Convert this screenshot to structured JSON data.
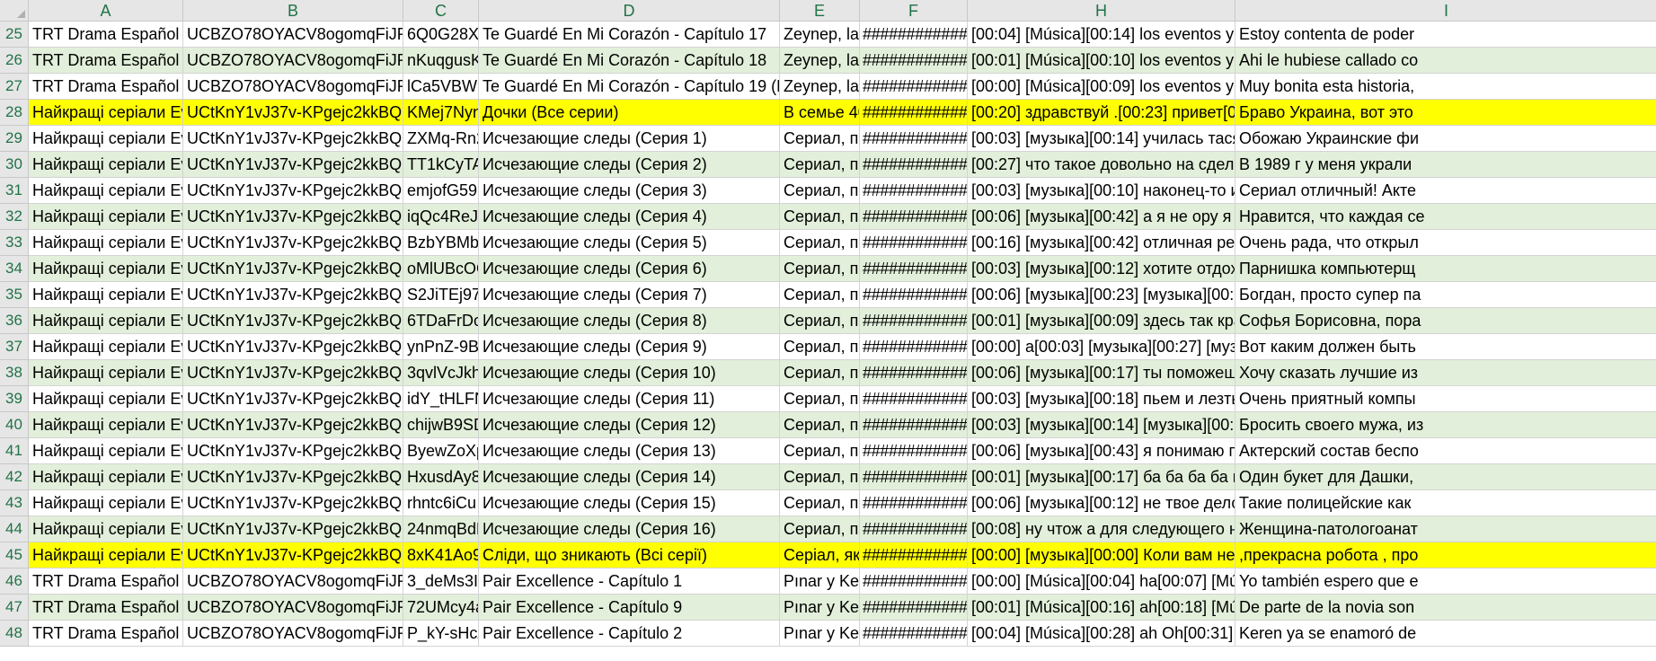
{
  "columns": [
    "A",
    "B",
    "C",
    "D",
    "E",
    "F",
    "H",
    "I"
  ],
  "rows": [
    {
      "num": "25",
      "band": "white",
      "cells": [
        "TRT Drama Español",
        "UCBZO78OYACV8ogomqFiJR4Q",
        "6Q0G28XU",
        "Te Guardé En Mi Corazón - Capítulo 17",
        "Zeynep, la g",
        "############",
        "[00:04] [Música][00:14] los eventos y p",
        "Estoy contenta de poder"
      ]
    },
    {
      "num": "26",
      "band": "green",
      "cells": [
        "TRT Drama Español",
        "UCBZO78OYACV8ogomqFiJR4Q",
        "nKuqgusK5",
        "Te Guardé En Mi Corazón - Capítulo 18",
        "Zeynep, la g",
        "############",
        "[00:01] [Música][00:10] los eventos y p",
        "Ahi le hubiese callado co"
      ]
    },
    {
      "num": "27",
      "band": "white",
      "cells": [
        "TRT Drama Español",
        "UCBZO78OYACV8ogomqFiJR4Q",
        "lCa5VBW9",
        "Te Guardé En Mi Corazón - Capítulo 19 (FIN",
        "Zeynep, la g",
        "############",
        "[00:00] [Música][00:09] los eventos y p",
        "Muy bonita esta historia,"
      ]
    },
    {
      "num": "28",
      "band": "hl",
      "cells": [
        "Найкращі серіали Eve",
        "UCtKnY1vJ37v-KPgejc2kkBQ",
        "KMej7Nyn",
        "Дочки (Все серии)",
        "В семье 40",
        "############",
        "[00:20] здравствуй .[00:23] привет[00",
        "Браво Украина, вот это"
      ]
    },
    {
      "num": "29",
      "band": "white",
      "cells": [
        "Найкращі серіали Eve",
        "UCtKnY1vJ37v-KPgejc2kkBQ",
        "ZXMq-Rn2",
        "Исчезающие следы (Серия 1)",
        "Сериал, по",
        "############",
        "[00:03] [музыка][00:14] училась тася",
        "Обожаю Украинские фи"
      ]
    },
    {
      "num": "30",
      "band": "green",
      "cells": [
        "Найкращі серіали Eve",
        "UCtKnY1vJ37v-KPgejc2kkBQ",
        "TT1kCyTAi",
        "Исчезающие следы (Серия 2)",
        "Сериал, по",
        "############",
        "[00:27] что такое довольно на сдела",
        "В  1989 г у меня украли"
      ]
    },
    {
      "num": "31",
      "band": "white",
      "cells": [
        "Найкращі серіали Eve",
        "UCtKnY1vJ37v-KPgejc2kkBQ",
        "emjofG59r",
        "Исчезающие следы (Серия 3)",
        "Сериал, по",
        "############",
        "[00:03] [музыка][00:10] наконец-то и",
        "Сериал отличный! Акте"
      ]
    },
    {
      "num": "32",
      "band": "green",
      "cells": [
        "Найкращі серіали Eve",
        "UCtKnY1vJ37v-KPgejc2kkBQ",
        "iqQc4ReJx",
        "Исчезающие следы (Серия 4)",
        "Сериал, по",
        "############",
        "[00:06] [музыка][00:42] а я не ору я п",
        "Нравится, что каждая се"
      ]
    },
    {
      "num": "33",
      "band": "white",
      "cells": [
        "Найкращі серіали Eve",
        "UCtKnY1vJ37v-KPgejc2kkBQ",
        "BzbYBMb_",
        "Исчезающие следы (Серия 5)",
        "Сериал, по",
        "############",
        "[00:16] [музыка][00:42] отличная реа",
        "Очень рада, что открыл"
      ]
    },
    {
      "num": "34",
      "band": "green",
      "cells": [
        "Найкращі серіали Eve",
        "UCtKnY1vJ37v-KPgejc2kkBQ",
        "oMlUBcOC",
        "Исчезающие следы (Серия 6)",
        "Сериал, по",
        "############",
        "[00:03] [музыка][00:12] хотите отдох",
        "Парнишка компьютерщ"
      ]
    },
    {
      "num": "35",
      "band": "white",
      "cells": [
        "Найкращі серіали Eve",
        "UCtKnY1vJ37v-KPgejc2kkBQ",
        "S2JiTEj97Q",
        "Исчезающие следы (Серия 7)",
        "Сериал, по",
        "############",
        "[00:06] [музыка][00:23] [музыка][00:3",
        "Богдан, просто супер па"
      ]
    },
    {
      "num": "36",
      "band": "green",
      "cells": [
        "Найкращі серіали Eve",
        "UCtKnY1vJ37v-KPgejc2kkBQ",
        "6TDaFrDo",
        "Исчезающие следы (Серия 8)",
        "Сериал, по",
        "############",
        "[00:01] [музыка][00:09] здесь так кра",
        "Софья Борисовна, пора"
      ]
    },
    {
      "num": "37",
      "band": "white",
      "cells": [
        "Найкращі серіали Eve",
        "UCtKnY1vJ37v-KPgejc2kkBQ",
        "ynPnZ-9Bz",
        "Исчезающие следы (Серия 9)",
        "Сериал, по",
        "############",
        "[00:00] a[00:03] [музыка][00:27] [муз",
        "Вот каким должен быть"
      ]
    },
    {
      "num": "38",
      "band": "green",
      "cells": [
        "Найкращі серіали Eve",
        "UCtKnY1vJ37v-KPgejc2kkBQ",
        "3qvlVcJkh",
        "Исчезающие следы (Серия 10)",
        "Сериал, по",
        "############",
        "[00:06] [музыка][00:17] ты поможеш",
        "Хочу сказать лучшие из"
      ]
    },
    {
      "num": "39",
      "band": "white",
      "cells": [
        "Найкращі серіали Eve",
        "UCtKnY1vJ37v-KPgejc2kkBQ",
        "idY_tHLFN",
        "Исчезающие следы (Серия 11)",
        "Сериал, по",
        "############",
        "[00:03] [музыка][00:18] пьем и лезть",
        "Очень приятный компы"
      ]
    },
    {
      "num": "40",
      "band": "green",
      "cells": [
        "Найкращі серіали Eve",
        "UCtKnY1vJ37v-KPgejc2kkBQ",
        "chijwB9SD",
        "Исчезающие следы (Серия 12)",
        "Сериал, по",
        "############",
        "[00:03] [музыка][00:14] [музыка][00:3",
        "Бросить своего мужа, из"
      ]
    },
    {
      "num": "41",
      "band": "white",
      "cells": [
        "Найкращі серіали Eve",
        "UCtKnY1vJ37v-KPgejc2kkBQ",
        "ByewZoXp",
        "Исчезающие следы (Серия 13)",
        "Сериал, по",
        "############",
        "[00:06] [музыка][00:43] я понимаю по",
        "Актерский состав беспо"
      ]
    },
    {
      "num": "42",
      "band": "green",
      "cells": [
        "Найкращі серіали Eve",
        "UCtKnY1vJ37v-KPgejc2kkBQ",
        "HxusdAy8I",
        "Исчезающие следы (Серия 14)",
        "Сериал, по",
        "############",
        "[00:01] [музыка][00:17] ба ба ба ба п",
        "Один букет для Дашки,"
      ]
    },
    {
      "num": "43",
      "band": "white",
      "cells": [
        "Найкращі серіали Eve",
        "UCtKnY1vJ37v-KPgejc2kkBQ",
        "rhntc6iCu",
        "Исчезающие следы (Серия 15)",
        "Сериал, по",
        "############",
        "[00:06] [музыка][00:12] не твое дело",
        "Такие полицейские как"
      ]
    },
    {
      "num": "44",
      "band": "green",
      "cells": [
        "Найкращі серіали Eve",
        "UCtKnY1vJ37v-KPgejc2kkBQ",
        "24nmqBdF",
        "Исчезающие следы (Серия 16)",
        "Сериал, по",
        "############",
        "[00:08] ну чтож а для следующего но",
        "Женщина-патологоанат"
      ]
    },
    {
      "num": "45",
      "band": "hl",
      "cells": [
        "Найкращі серіали Eve",
        "UCtKnY1vJ37v-KPgejc2kkBQ",
        "8xK41Ao9l",
        "Сліди, що зникають (Всі серії)",
        "Серіал, які",
        "############",
        "[00:00] [музыка][00:00] Коли вам нех",
        ",прекрасна робота , про"
      ]
    },
    {
      "num": "46",
      "band": "white",
      "cells": [
        "TRT Drama Español",
        "UCBZO78OYACV8ogomqFiJR4Q",
        "3_deMs3I",
        "Pair Excellence  - Capítulo 1",
        "Pınar y Kere",
        "############",
        "[00:00] [Música][00:04] ha[00:07] [Mú",
        "Yo también espero que e"
      ]
    },
    {
      "num": "47",
      "band": "green",
      "cells": [
        "TRT Drama Español",
        "UCBZO78OYACV8ogomqFiJR4Q",
        "72UMcy4a",
        "Pair Excellence  - Capítulo 9",
        "Pınar y Kere",
        "############",
        "[00:01] [Música][00:16] ah[00:18] [Mú",
        "De parte de la novia son"
      ]
    },
    {
      "num": "48",
      "band": "white",
      "cells": [
        "TRT Drama Español",
        "UCBZO78OYACV8ogomqFiJR4Q",
        "P_kY-sHcA",
        "Pair Excellence  - Capítulo 2",
        "Pınar y Kere",
        "############",
        "[00:04] [Música][00:28] ah Oh[00:31] [",
        "Keren ya se enamoró de"
      ]
    }
  ]
}
